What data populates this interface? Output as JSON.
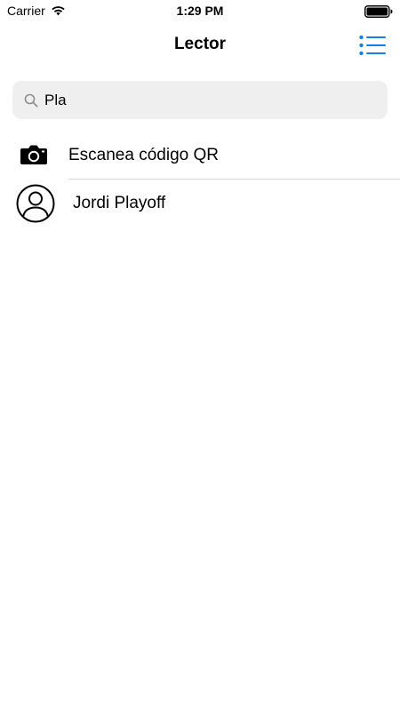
{
  "status_bar": {
    "carrier": "Carrier",
    "time": "1:29 PM"
  },
  "nav": {
    "title": "Lector",
    "menu_icon": "list-bullet-icon"
  },
  "search": {
    "icon": "magnifier-icon",
    "value": "Pla"
  },
  "results": [
    {
      "icon": "camera-icon",
      "label": "Escanea código QR"
    },
    {
      "icon": "person-circle-icon",
      "label": "Jordi Playoff"
    }
  ],
  "colors": {
    "accent": "#1a7fe0",
    "search_bg": "#efeff0",
    "divider": "#d6d6d8"
  }
}
